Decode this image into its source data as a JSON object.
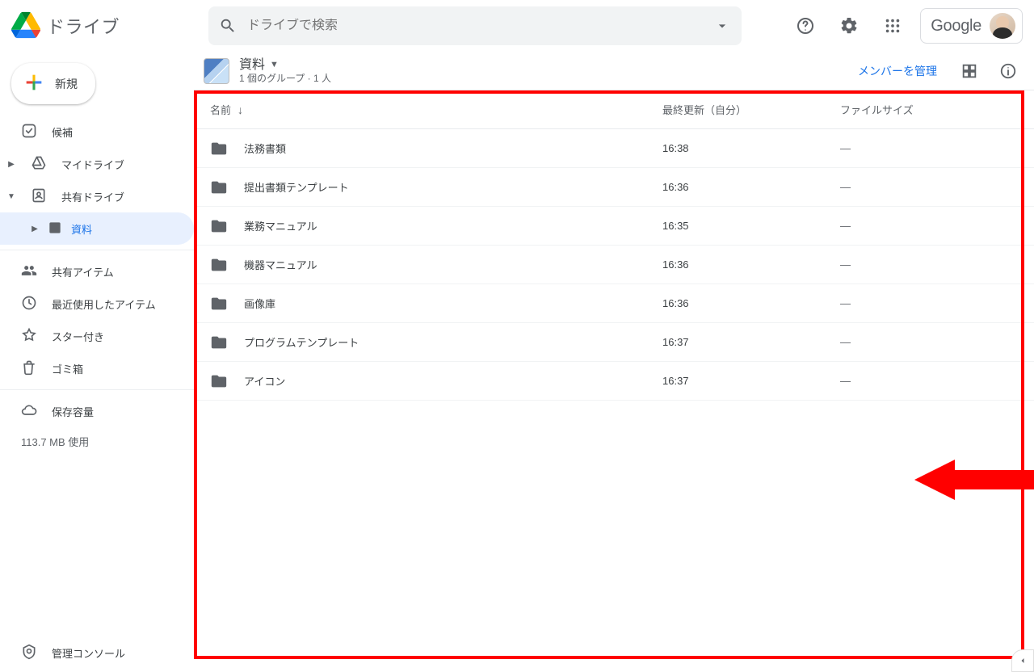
{
  "app": {
    "name": "ドライブ"
  },
  "search": {
    "placeholder": "ドライブで検索"
  },
  "account": {
    "brand": "Google"
  },
  "new_button": {
    "label": "新規"
  },
  "sidebar": {
    "items": [
      {
        "label": "候補"
      },
      {
        "label": "マイドライブ"
      },
      {
        "label": "共有ドライブ"
      }
    ],
    "sub_item": {
      "label": "資料"
    },
    "items2": [
      {
        "label": "共有アイテム"
      },
      {
        "label": "最近使用したアイテム"
      },
      {
        "label": "スター付き"
      },
      {
        "label": "ゴミ箱"
      }
    ],
    "storage_label": "保存容量",
    "storage_used": "113.7 MB 使用",
    "admin_label": "管理コンソール"
  },
  "header_icons": {
    "help": "help-icon",
    "settings": "gear-icon",
    "apps": "apps-icon"
  },
  "path": {
    "title": "資料",
    "subtitle": "1 個のグループ · 1 人"
  },
  "actions": {
    "manage_members": "メンバーを管理"
  },
  "columns": {
    "name": "名前",
    "modified": "最終更新（自分）",
    "size": "ファイルサイズ"
  },
  "rows": [
    {
      "name": "法務書類",
      "modified": "16:38",
      "size": "—"
    },
    {
      "name": "提出書類テンプレート",
      "modified": "16:36",
      "size": "—"
    },
    {
      "name": "業務マニュアル",
      "modified": "16:35",
      "size": "—"
    },
    {
      "name": "機器マニュアル",
      "modified": "16:36",
      "size": "—"
    },
    {
      "name": "画像庫",
      "modified": "16:36",
      "size": "—"
    },
    {
      "name": "プログラムテンプレート",
      "modified": "16:37",
      "size": "—"
    },
    {
      "name": "アイコン",
      "modified": "16:37",
      "size": "—"
    }
  ]
}
